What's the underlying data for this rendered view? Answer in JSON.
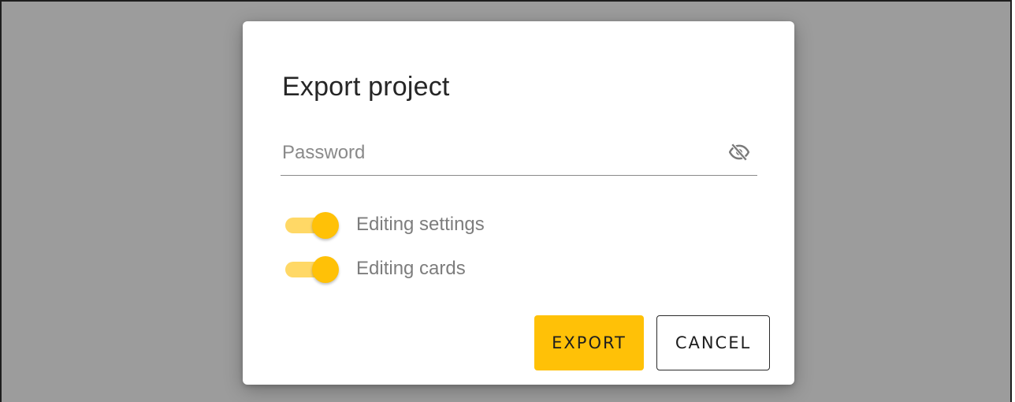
{
  "dialog": {
    "title": "Export project",
    "password": {
      "placeholder": "Password",
      "value": "",
      "visibility_icon": "eye-off-icon"
    },
    "toggles": [
      {
        "label": "Editing settings",
        "checked": true
      },
      {
        "label": "Editing cards",
        "checked": true
      }
    ],
    "buttons": {
      "export_label": "EXPORT",
      "cancel_label": "CANCEL"
    }
  },
  "colors": {
    "backdrop": "#9c9c9c",
    "accent": "#ffc107",
    "accent_track": "#ffd866",
    "dialog_bg": "#ffffff"
  }
}
